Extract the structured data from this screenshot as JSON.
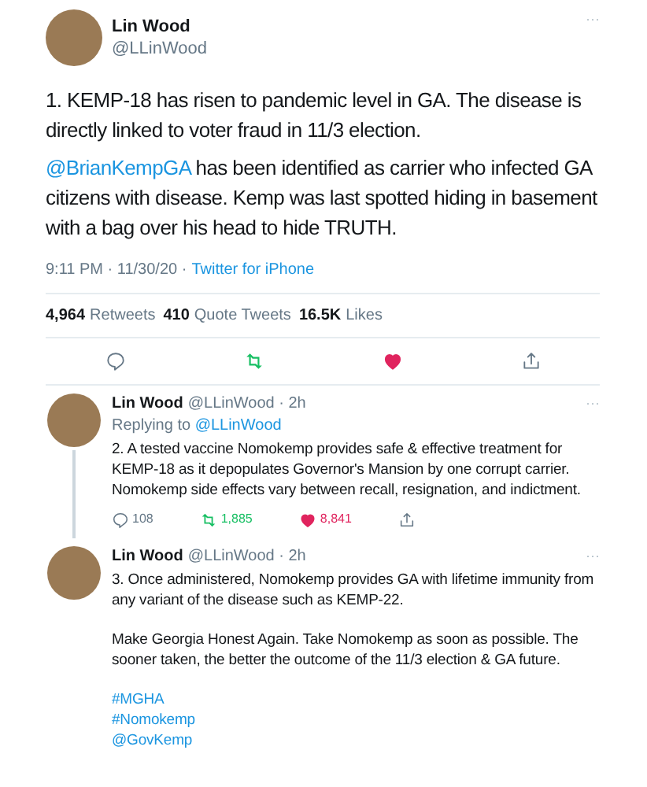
{
  "main_tweet": {
    "author": "Lin Wood",
    "handle": "@LLinWood",
    "more": "···",
    "paragraphs": [
      [
        {
          "kind": "text",
          "text": "1. KEMP-18 has risen to pandemic level in GA. The disease is directly linked to voter fraud in 11/3 election."
        }
      ],
      [
        {
          "kind": "mention",
          "text": "@BrianKempGA"
        },
        {
          "kind": "text",
          "text": " has been identified as carrier who infected GA citizens with disease. Kemp was last spotted hiding in basement with a bag over his head to hide TRUTH."
        }
      ]
    ],
    "timestamp": "9:11 PM · 11/30/20 ·",
    "source": "Twitter for iPhone",
    "stats": [
      {
        "count": "4,964",
        "label": "Retweets"
      },
      {
        "count": "410",
        "label": "Quote Tweets"
      },
      {
        "count": "16.5K",
        "label": "Likes"
      }
    ],
    "liked": true
  },
  "replies": [
    {
      "author": "Lin Wood",
      "handle": "@LLinWood · 2h",
      "more": "···",
      "replying_label": "Replying to",
      "replying_to": "@LLinWood",
      "paragraphs": [
        [
          {
            "kind": "text",
            "text": "2. A tested vaccine Nomokemp provides safe & effective treatment for KEMP-18 as it depopulates Governor's Mansion by one corrupt carrier. Nomokemp side effects vary between recall, resignation, and indictment."
          }
        ]
      ],
      "counts": {
        "replies": "108",
        "retweets": "1,885",
        "likes": "8,841"
      },
      "liked": true
    },
    {
      "author": "Lin Wood",
      "handle": "@LLinWood · 2h",
      "more": "···",
      "paragraphs": [
        [
          {
            "kind": "text",
            "text": "3. Once administered, Nomokemp provides GA with lifetime immunity from any variant of the disease such as KEMP-22."
          }
        ],
        [
          {
            "kind": "text",
            "text": "Make Georgia Honest Again. Take Nomokemp as soon as possible. The sooner taken, the better the outcome of the 11/3 election & GA future."
          }
        ],
        [
          {
            "kind": "hashtag",
            "text": "#MGHA"
          }
        ],
        [
          {
            "kind": "hashtag",
            "text": "#Nomokemp"
          }
        ],
        [
          {
            "kind": "mention",
            "text": "@GovKemp"
          }
        ]
      ]
    }
  ]
}
